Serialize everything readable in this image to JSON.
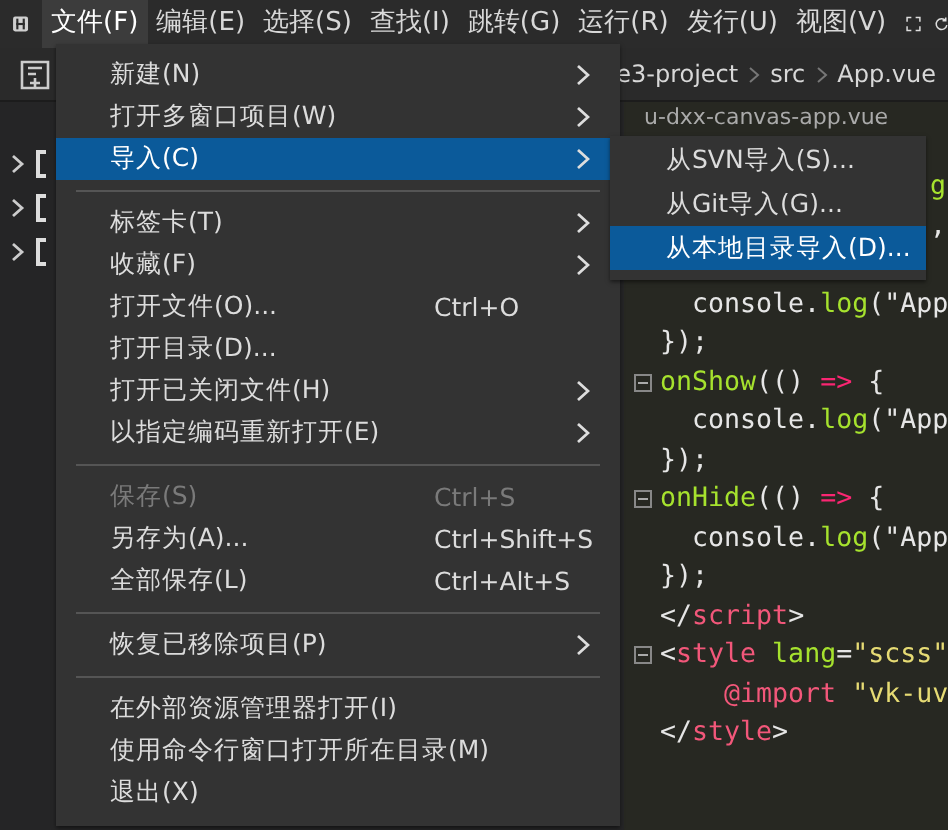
{
  "menubar": {
    "items": [
      {
        "label": "文件(F)",
        "selected": true
      },
      {
        "label": "编辑(E)",
        "selected": false
      },
      {
        "label": "选择(S)",
        "selected": false
      },
      {
        "label": "查找(I)",
        "selected": false
      },
      {
        "label": "跳转(G)",
        "selected": false
      },
      {
        "label": "运行(R)",
        "selected": false
      },
      {
        "label": "发行(U)",
        "selected": false
      },
      {
        "label": "视图(V)",
        "selected": false
      }
    ]
  },
  "toolbar": {
    "breadcrumb": [
      "e3-project",
      "src",
      "App.vue"
    ]
  },
  "sidebar": {
    "items": [
      {
        "expanded": false
      },
      {
        "expanded": false
      },
      {
        "expanded": false
      }
    ]
  },
  "editor": {
    "tab": "u-dxx-canvas-app.vue",
    "lines": [
      {
        "kind": "tail",
        "tokens": [
          {
            "color": "#a6e22e",
            "text": "g"
          }
        ]
      },
      {
        "kind": "tail",
        "tokens": [
          {
            "color": "#e6e6e6",
            "text": ","
          }
        ]
      },
      {
        "kind": "blank"
      },
      {
        "kind": "code",
        "fold": false,
        "tokens": [
          {
            "color": "#e6e6e6",
            "text": "  console."
          },
          {
            "color": "#a6e22e",
            "text": "log"
          },
          {
            "color": "#e6e6e6",
            "text": "(\"App"
          }
        ]
      },
      {
        "kind": "code",
        "fold": false,
        "tokens": [
          {
            "color": "#e6e6e6",
            "text": "});"
          }
        ]
      },
      {
        "kind": "code",
        "fold": true,
        "tokens": [
          {
            "color": "#a6e22e",
            "text": "onShow"
          },
          {
            "color": "#e6e6e6",
            "text": "(() "
          },
          {
            "color": "#f92672",
            "text": "=>"
          },
          {
            "color": "#e6e6e6",
            "text": " {"
          }
        ]
      },
      {
        "kind": "code",
        "fold": false,
        "tokens": [
          {
            "color": "#e6e6e6",
            "text": "  console."
          },
          {
            "color": "#a6e22e",
            "text": "log"
          },
          {
            "color": "#e6e6e6",
            "text": "(\"App"
          }
        ]
      },
      {
        "kind": "code",
        "fold": false,
        "tokens": [
          {
            "color": "#e6e6e6",
            "text": "});"
          }
        ]
      },
      {
        "kind": "code",
        "fold": true,
        "tokens": [
          {
            "color": "#a6e22e",
            "text": "onHide"
          },
          {
            "color": "#e6e6e6",
            "text": "(() "
          },
          {
            "color": "#f92672",
            "text": "=>"
          },
          {
            "color": "#e6e6e6",
            "text": " {"
          }
        ]
      },
      {
        "kind": "code",
        "fold": false,
        "tokens": [
          {
            "color": "#e6e6e6",
            "text": "  console."
          },
          {
            "color": "#a6e22e",
            "text": "log"
          },
          {
            "color": "#e6e6e6",
            "text": "(\"App"
          }
        ]
      },
      {
        "kind": "code",
        "fold": false,
        "tokens": [
          {
            "color": "#e6e6e6",
            "text": "});"
          }
        ]
      },
      {
        "kind": "code",
        "fold": false,
        "tokens": [
          {
            "color": "#e6e6e6",
            "text": "</"
          },
          {
            "color": "#f2577a",
            "text": "script"
          },
          {
            "color": "#e6e6e6",
            "text": ">"
          }
        ]
      },
      {
        "kind": "code",
        "fold": true,
        "tokens": [
          {
            "color": "#e6e6e6",
            "text": "<"
          },
          {
            "color": "#f2577a",
            "text": "style"
          },
          {
            "color": "#a6e22e",
            "text": " lang"
          },
          {
            "color": "#e6e6e6",
            "text": "="
          },
          {
            "color": "#e6db74",
            "text": "\"scss\""
          }
        ]
      },
      {
        "kind": "code",
        "fold": false,
        "tokens": [
          {
            "color": "#f2577a",
            "text": "    @import"
          },
          {
            "color": "#e6db74",
            "text": " \"vk-uv"
          }
        ]
      },
      {
        "kind": "code",
        "fold": false,
        "tokens": [
          {
            "color": "#e6e6e6",
            "text": "</"
          },
          {
            "color": "#f2577a",
            "text": "style"
          },
          {
            "color": "#e6e6e6",
            "text": ">"
          }
        ]
      }
    ]
  },
  "file_menu": {
    "items": [
      {
        "kind": "item",
        "label": "新建(N)",
        "submenu": true,
        "selected": false,
        "disabled": false
      },
      {
        "kind": "item",
        "label": "打开多窗口项目(W)",
        "submenu": true,
        "selected": false,
        "disabled": false
      },
      {
        "kind": "item",
        "label": "导入(C)",
        "submenu": true,
        "selected": true,
        "disabled": false
      },
      {
        "kind": "separator"
      },
      {
        "kind": "item",
        "label": "标签卡(T)",
        "submenu": true,
        "selected": false,
        "disabled": false
      },
      {
        "kind": "item",
        "label": "收藏(F)",
        "submenu": true,
        "selected": false,
        "disabled": false
      },
      {
        "kind": "item",
        "label": "打开文件(O)...",
        "shortcut": "Ctrl+O",
        "submenu": false,
        "selected": false,
        "disabled": false
      },
      {
        "kind": "item",
        "label": "打开目录(D)...",
        "submenu": false,
        "selected": false,
        "disabled": false
      },
      {
        "kind": "item",
        "label": "打开已关闭文件(H)",
        "submenu": true,
        "selected": false,
        "disabled": false
      },
      {
        "kind": "item",
        "label": "以指定编码重新打开(E)",
        "submenu": true,
        "selected": false,
        "disabled": false
      },
      {
        "kind": "separator"
      },
      {
        "kind": "item",
        "label": "保存(S)",
        "shortcut": "Ctrl+S",
        "submenu": false,
        "selected": false,
        "disabled": true
      },
      {
        "kind": "item",
        "label": "另存为(A)...",
        "shortcut": "Ctrl+Shift+S",
        "submenu": false,
        "selected": false,
        "disabled": false
      },
      {
        "kind": "item",
        "label": "全部保存(L)",
        "shortcut": "Ctrl+Alt+S",
        "submenu": false,
        "selected": false,
        "disabled": false
      },
      {
        "kind": "separator"
      },
      {
        "kind": "item",
        "label": "恢复已移除项目(P)",
        "submenu": true,
        "selected": false,
        "disabled": false
      },
      {
        "kind": "separator"
      },
      {
        "kind": "item",
        "label": "在外部资源管理器打开(I)",
        "submenu": false,
        "selected": false,
        "disabled": false
      },
      {
        "kind": "item",
        "label": "使用命令行窗口打开所在目录(M)",
        "submenu": false,
        "selected": false,
        "disabled": false
      },
      {
        "kind": "item",
        "label": "退出(X)",
        "submenu": false,
        "selected": false,
        "disabled": false
      }
    ]
  },
  "import_submenu": {
    "items": [
      {
        "kind": "item",
        "label": "从SVN导入(S)...",
        "submenu": false,
        "selected": false,
        "disabled": false
      },
      {
        "kind": "item",
        "label": "从Git导入(G)...",
        "submenu": false,
        "selected": false,
        "disabled": false
      },
      {
        "kind": "item",
        "label": "从本地目录导入(D)...",
        "submenu": false,
        "selected": true,
        "disabled": false
      }
    ]
  }
}
